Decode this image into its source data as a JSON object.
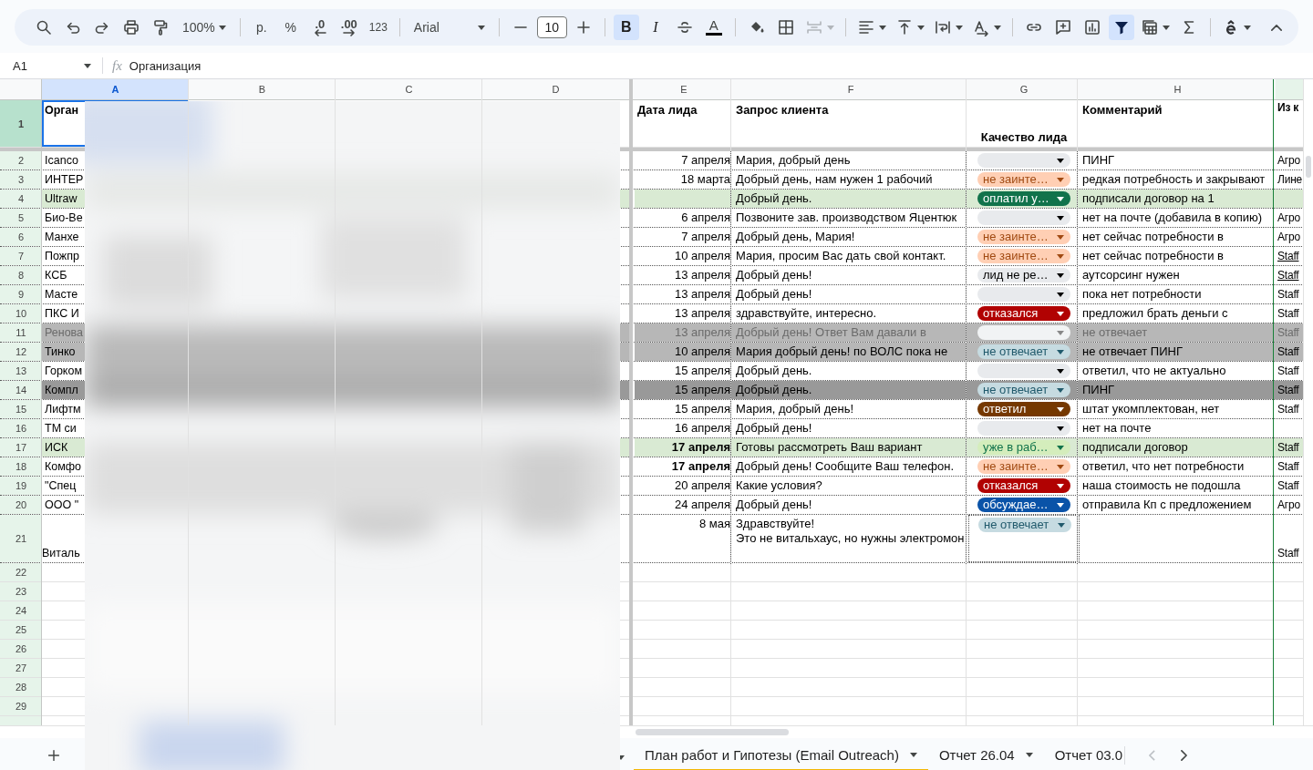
{
  "toolbar": [
    {
      "kind": "icon",
      "selected": false,
      "disabled": false,
      "caret": false
    },
    {
      "kind": "icon",
      "selected": false,
      "disabled": false,
      "caret": false
    },
    {
      "kind": "icon",
      "selected": false,
      "disabled": false,
      "caret": false
    },
    {
      "kind": "icon",
      "selected": false,
      "disabled": false,
      "caret": false
    },
    {
      "kind": "icon",
      "selected": false,
      "disabled": false,
      "caret": false
    },
    {
      "kind": "dropdown",
      "label": "100%"
    },
    {
      "kind": "separator"
    },
    {
      "kind": "text",
      "label": "р."
    },
    {
      "kind": "text",
      "label": "%"
    },
    {
      "kind": "text-arrow",
      "label": ".0"
    },
    {
      "kind": "text-arrow",
      "label": ".00"
    },
    {
      "kind": "text",
      "label": "123"
    },
    {
      "kind": "separator"
    },
    {
      "kind": "font",
      "label": "Arial"
    },
    {
      "kind": "separator"
    },
    {
      "kind": "icon",
      "selected": false,
      "disabled": false,
      "caret": false
    },
    {
      "kind": "field",
      "value": "10"
    },
    {
      "kind": "icon",
      "selected": false,
      "disabled": false,
      "caret": false
    },
    {
      "kind": "separator"
    },
    {
      "kind": "toggle",
      "label": "B",
      "selected": true
    },
    {
      "kind": "toggle",
      "label": "I",
      "selected": false
    },
    {
      "kind": "icon",
      "selected": false,
      "disabled": false,
      "caret": false
    },
    {
      "kind": "color",
      "label": "A",
      "color": "#000000"
    },
    {
      "kind": "separator"
    },
    {
      "kind": "icon",
      "selected": false,
      "disabled": false,
      "caret": false
    },
    {
      "kind": "icon",
      "selected": false,
      "disabled": false,
      "caret": false
    },
    {
      "kind": "icon",
      "selected": false,
      "disabled": true,
      "caret": true
    },
    {
      "kind": "separator"
    },
    {
      "kind": "icon",
      "selected": false,
      "disabled": false,
      "caret": true
    },
    {
      "kind": "icon",
      "selected": false,
      "disabled": false,
      "caret": true
    },
    {
      "kind": "icon",
      "selected": false,
      "disabled": false,
      "caret": true
    },
    {
      "kind": "icon",
      "selected": false,
      "disabled": false,
      "caret": true
    },
    {
      "kind": "separator"
    },
    {
      "kind": "icon",
      "selected": false,
      "disabled": false,
      "caret": false
    },
    {
      "kind": "icon",
      "selected": false,
      "disabled": false,
      "caret": false
    },
    {
      "kind": "icon",
      "selected": false,
      "disabled": false,
      "caret": false
    },
    {
      "kind": "icon",
      "selected": true,
      "disabled": false,
      "caret": false
    },
    {
      "kind": "icon",
      "selected": false,
      "disabled": false,
      "caret": true
    },
    {
      "kind": "icon",
      "selected": false,
      "disabled": false,
      "caret": false
    },
    {
      "kind": "separator"
    },
    {
      "kind": "icon",
      "selected": false,
      "disabled": false,
      "caret": true
    },
    {
      "kind": "collapse"
    }
  ],
  "formula_bar": {
    "cell": "A1",
    "fx": "fx",
    "value": "Организация"
  },
  "columns": [
    {
      "letter": "A",
      "selected": true
    },
    {
      "letter": "B",
      "selected": false
    },
    {
      "letter": "C",
      "selected": false
    },
    {
      "letter": "D",
      "selected": false
    },
    {
      "letter": "E",
      "selected": false
    },
    {
      "letter": "F",
      "selected": false
    },
    {
      "letter": "G",
      "selected": false
    },
    {
      "letter": "H",
      "selected": false
    }
  ],
  "header_row": {
    "number": "1",
    "organization": "Орган",
    "date": "Дата лида",
    "request": "Запрос клиента",
    "quality": "Качество лида",
    "comment": "Комментарий",
    "column_i": "Из к"
  },
  "rows": [
    {
      "number": "2",
      "organization": "Icanco",
      "date": "7 апреля",
      "request": "Мария, добрый день",
      "quality": {
        "color": "#e8eaed"
      },
      "comment": "ПИНГ",
      "column_i": "Агро",
      "color": "#ffffff",
      "bold_date": false,
      "muted": false,
      "link": false
    },
    {
      "number": "3",
      "organization": "ИНТЕР",
      "date": "18 марта",
      "request": "Добрый день, нам нужен 1 рабочий",
      "quality": {
        "label": "не заинте…",
        "color": "#ffcfb4"
      },
      "comment": "редкая потребность и закрывают",
      "column_i": "Лине",
      "color": "#ffffff",
      "bold_date": false,
      "muted": false,
      "link": false
    },
    {
      "number": "4",
      "organization": "Ultraw",
      "request": "Добрый день.",
      "quality": {
        "label": "оплатил у…",
        "color": "#11734b"
      },
      "comment": "подписали договор на 1",
      "color": "#d9ead3",
      "muted": false
    },
    {
      "number": "5",
      "organization": "Био-Ве",
      "date": "6 апреля",
      "request": "Позвоните зав. производством Яцентюк",
      "quality": {
        "color": "#e8eaed"
      },
      "comment": "нет на почте (добавила в копию)",
      "column_i": "Агро",
      "color": "#ffffff",
      "bold_date": false,
      "muted": false,
      "link": false
    },
    {
      "number": "6",
      "organization": "Манхе",
      "date": "7 апреля",
      "request": "Добрый день, Мария!",
      "quality": {
        "label": "не заинте…",
        "color": "#ffcfb4"
      },
      "comment": "нет сейчас потребности в",
      "column_i": "Агро",
      "color": "#ffffff",
      "bold_date": false,
      "muted": false,
      "link": false
    },
    {
      "number": "7",
      "organization": "Пожпр",
      "date": "10 апреля",
      "request": "Мария, просим Вас дать свой контакт.",
      "quality": {
        "label": "не заинте…",
        "color": "#ffcfb4"
      },
      "comment": "нет сейчас потребности в",
      "column_i": "Staff",
      "color": "#ffffff",
      "bold_date": false,
      "muted": false,
      "link": true
    },
    {
      "number": "8",
      "organization": "КСБ",
      "date": "13 апреля",
      "request": "Добрый день!",
      "quality": {
        "label": "лид не ре…",
        "color": "#e8eaed"
      },
      "comment": "аутсорсинг нужен",
      "column_i": "Staff",
      "color": "#ffffff",
      "bold_date": false,
      "muted": false,
      "link": true
    },
    {
      "number": "9",
      "organization": "Масте",
      "date": "13 апреля",
      "request": "Добрый день!",
      "quality": {
        "color": "#e8eaed"
      },
      "comment": "пока нет потребности",
      "column_i": "Staff",
      "color": "#ffffff",
      "bold_date": false,
      "muted": false,
      "link": false
    },
    {
      "number": "10",
      "organization": "ПКС И",
      "date": "13 апреля",
      "request": "здравствуйте, интересно.",
      "quality": {
        "label": "отказался",
        "color": "#b10202"
      },
      "comment": "предложил брать деньги с",
      "column_i": "Staff",
      "color": "#ffffff",
      "bold_date": false,
      "muted": false,
      "link": false
    },
    {
      "number": "11",
      "organization": "Ренова",
      "date": "13 апреля",
      "request": "Добрый день! Ответ Вам давали в",
      "quality": {
        "color": "#f1f3f4"
      },
      "comment": "не отвечает",
      "column_i": "Staff",
      "color": "#b7b7b7",
      "bold_date": false,
      "muted": true,
      "link": false
    },
    {
      "number": "12",
      "organization": "Тинко",
      "date": "10 апреля",
      "request": "Мария добрый день! по ВОЛС пока не",
      "quality": {
        "label": "не отвечает",
        "color": "#c6dbe1"
      },
      "comment": "не отвечает ПИНГ",
      "column_i": "Staff",
      "color": "#b7b7b7",
      "bold_date": false,
      "muted": false,
      "link": false
    },
    {
      "number": "13",
      "organization": "Горком",
      "date": "15 апреля",
      "request": "Добрый день.",
      "quality": {
        "color": "#e8eaed"
      },
      "comment": "ответил, что не актуально",
      "column_i": "Staff",
      "color": "#ffffff",
      "bold_date": false,
      "muted": false,
      "link": false
    },
    {
      "number": "14",
      "organization": "Компл",
      "date": "15 апреля",
      "request": "Добрый день.",
      "quality": {
        "label": "не отвечает",
        "color": "#c6dbe1"
      },
      "comment": "ПИНГ",
      "column_i": "Staff",
      "color": "#999999",
      "bold_date": false,
      "muted": false,
      "link": false
    },
    {
      "number": "15",
      "organization": "Лифтм",
      "date": "15 апреля",
      "request": "Мария, добрый день!",
      "quality": {
        "label": "ответил",
        "color": "#753800"
      },
      "comment": "штат укомплектован, нет",
      "column_i": "Staff",
      "color": "#ffffff",
      "bold_date": false,
      "muted": false,
      "link": false
    },
    {
      "number": "16",
      "organization": "ТМ си",
      "date": "16 апреля",
      "request": "Добрый день!",
      "quality": {
        "color": "#e8eaed"
      },
      "comment": "нет на почте",
      "color": "#ffffff",
      "bold_date": false,
      "muted": false
    },
    {
      "number": "17",
      "organization": "ИСК",
      "date": "17 апреля",
      "request": "Готовы рассмотреть Ваш вариант",
      "quality": {
        "label": "уже в раб…",
        "color": "#d4edbc"
      },
      "comment": "подписали договор",
      "column_i": "Staff",
      "color": "#d9ead3",
      "bold_date": true,
      "muted": false,
      "link": false
    },
    {
      "number": "18",
      "organization": "Комфо",
      "date": "17 апреля",
      "request": "Добрый день! Сообщите Ваш телефон.",
      "quality": {
        "label": "не заинте…",
        "color": "#ffcfb4"
      },
      "comment": "ответил, что нет потребности",
      "column_i": "Staff",
      "color": "#ffffff",
      "bold_date": true,
      "muted": false,
      "link": false
    },
    {
      "number": "19",
      "organization": "\"Спец",
      "date": "20 апреля",
      "request": "Какие условия?",
      "quality": {
        "label": "отказался",
        "color": "#b10202"
      },
      "comment": "наша стоимость не подошла",
      "column_i": "Staff",
      "color": "#ffffff",
      "bold_date": false,
      "muted": false,
      "link": false
    },
    {
      "number": "20",
      "organization": "ООО \"",
      "date": "24 апреля",
      "request": "Добрый день!",
      "quality": {
        "label": "обсуждае…",
        "color": "#0a53a8"
      },
      "comment": "отправила Кп с предложением",
      "column_i": "Агро",
      "color": "#ffffff",
      "bold_date": false,
      "muted": false,
      "link": false
    },
    {
      "number": "21",
      "organization": "Виталь",
      "date": "8 мая",
      "request": "Здравствуйте!\nЭто не витальхаус, но нужны электромон",
      "quality": {
        "label": "не отвечает",
        "color": "#c6dbe1"
      },
      "column_i": "Staff",
      "color": "#ffffff",
      "bold_date": false,
      "muted": false,
      "link": false
    }
  ],
  "empty_rows": [
    "22",
    "23",
    "24",
    "25",
    "26",
    "27",
    "28",
    "29"
  ],
  "sheet_tabs": [
    {
      "label": "План работ и Гипотезы (Email Outreach)",
      "selected": true
    },
    {
      "label": "Отчет 26.04",
      "selected": false
    },
    {
      "label": "Отчет 03.0",
      "selected": false
    }
  ]
}
